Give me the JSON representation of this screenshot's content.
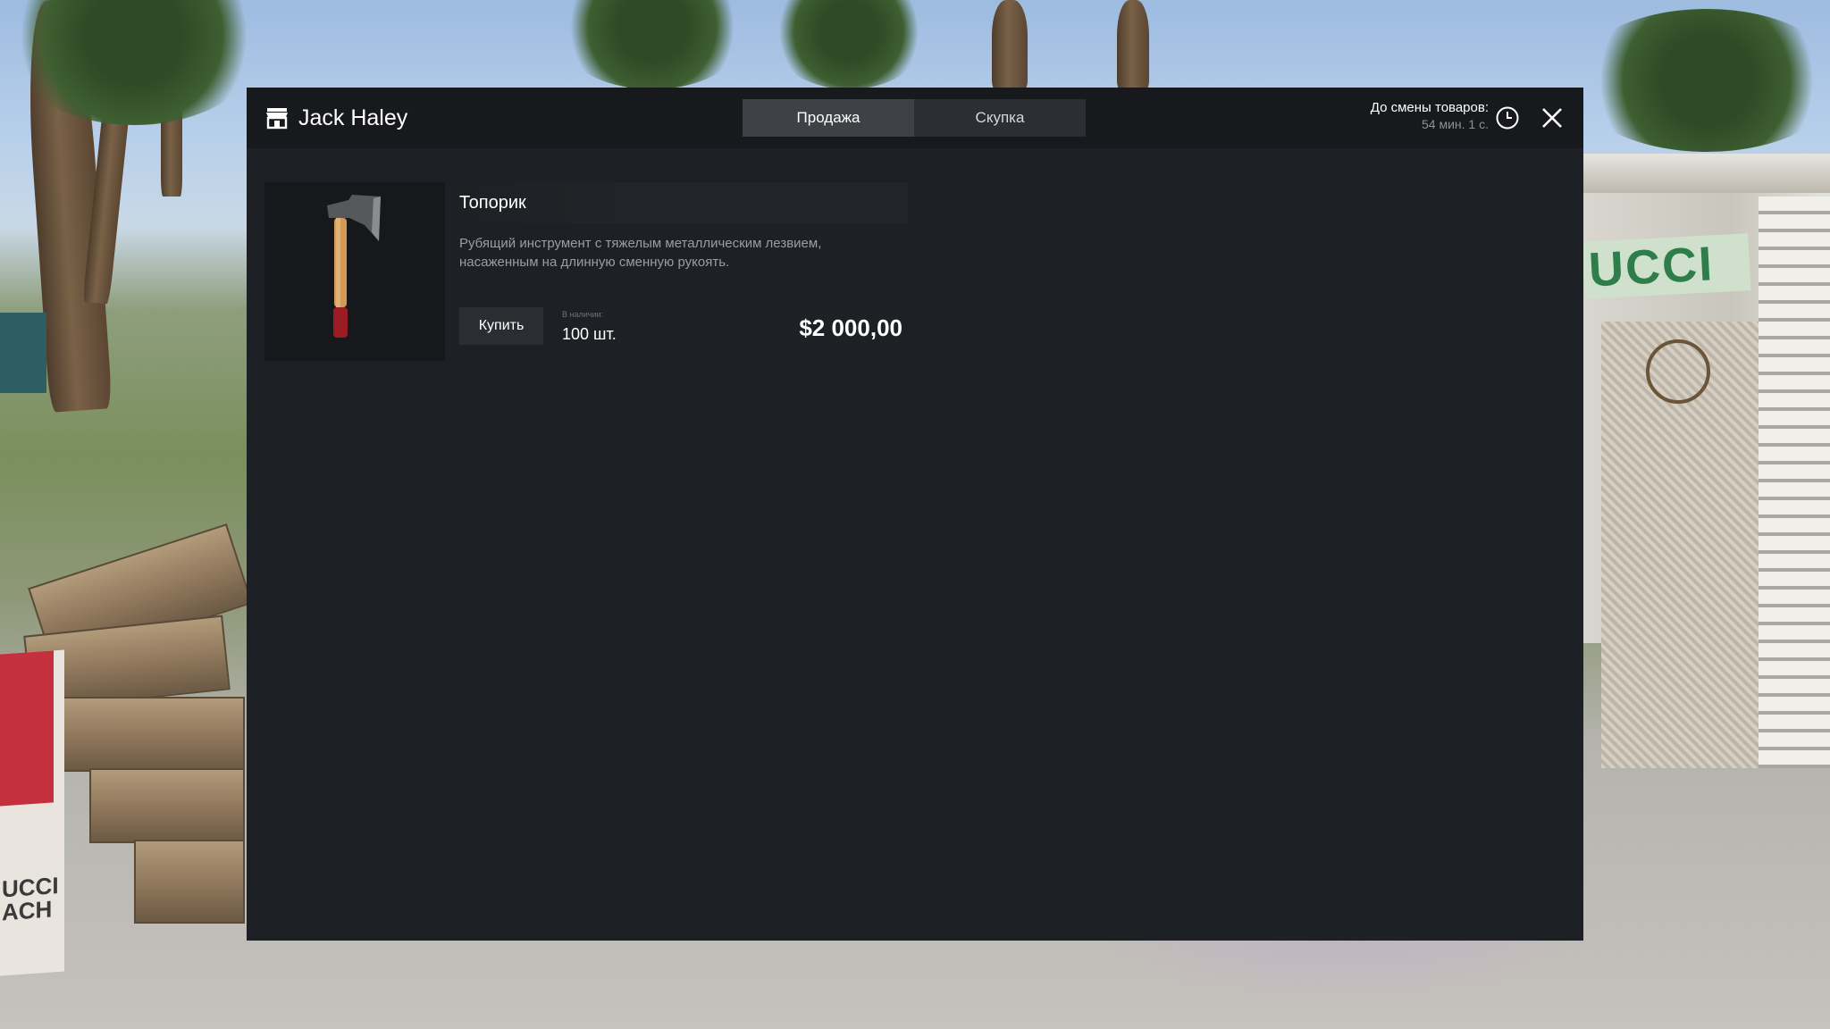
{
  "shop": {
    "name": "Jack Haley",
    "icon": "store-icon"
  },
  "tabs": [
    {
      "label": "Продажа",
      "active": true
    },
    {
      "label": "Скупка",
      "active": false
    }
  ],
  "timer": {
    "label": "До смены товаров:",
    "value": "54 мин. 1 с.",
    "icon": "clock-icon"
  },
  "close": {
    "icon": "close-icon"
  },
  "items": [
    {
      "name": "Топорик",
      "description": "Рубящий инструмент с тяжелым металлическим лезвием, насаженным на длинную сменную рукоять.",
      "buy_label": "Купить",
      "stock_label": "В наличии:",
      "stock_value": "100 шт.",
      "price": "$2 000,00",
      "image": "axe-icon"
    }
  ],
  "colors": {
    "panel": "#1d2024",
    "header": "#17191c",
    "tab_active": "#3e4146",
    "tab": "#2b2e32"
  }
}
